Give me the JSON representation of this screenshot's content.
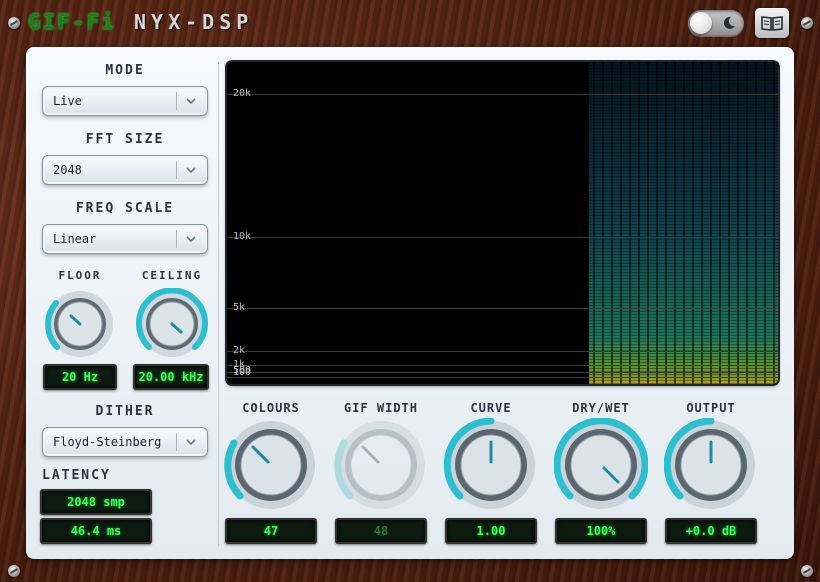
{
  "header": {
    "logo": "GIF-Fi",
    "product": "NYX-DSP"
  },
  "left": {
    "mode": {
      "label": "MODE",
      "value": "Live"
    },
    "fft": {
      "label": "FFT SIZE",
      "value": "2048"
    },
    "freq_scale": {
      "label": "FREQ SCALE",
      "value": "Linear"
    },
    "floor": {
      "label": "FLOOR",
      "value": "20 Hz"
    },
    "ceiling": {
      "label": "CEILING",
      "value": "20.00 kHz"
    },
    "dither": {
      "label": "DITHER",
      "value": "Floyd-Steinberg"
    },
    "latency": {
      "label": "LATENCY",
      "samples": "2048 smp",
      "ms": "46.4 ms"
    }
  },
  "spectrogram": {
    "freq_labels": [
      "20k",
      "10k",
      "5k",
      "2k",
      "1k",
      "500",
      "100"
    ]
  },
  "knobs": [
    {
      "label": "COLOURS",
      "value": "47",
      "enabled": true
    },
    {
      "label": "GIF WIDTH",
      "value": "48",
      "enabled": false
    },
    {
      "label": "CURVE",
      "value": "1.00",
      "enabled": true
    },
    {
      "label": "DRY/WET",
      "value": "100%",
      "enabled": true
    },
    {
      "label": "OUTPUT",
      "value": "+0.0 dB",
      "enabled": true
    }
  ],
  "colors": {
    "lcd_text": "#38ff5a",
    "accent_ring": "#2bbfd0",
    "logo": "#1f7a1f"
  }
}
